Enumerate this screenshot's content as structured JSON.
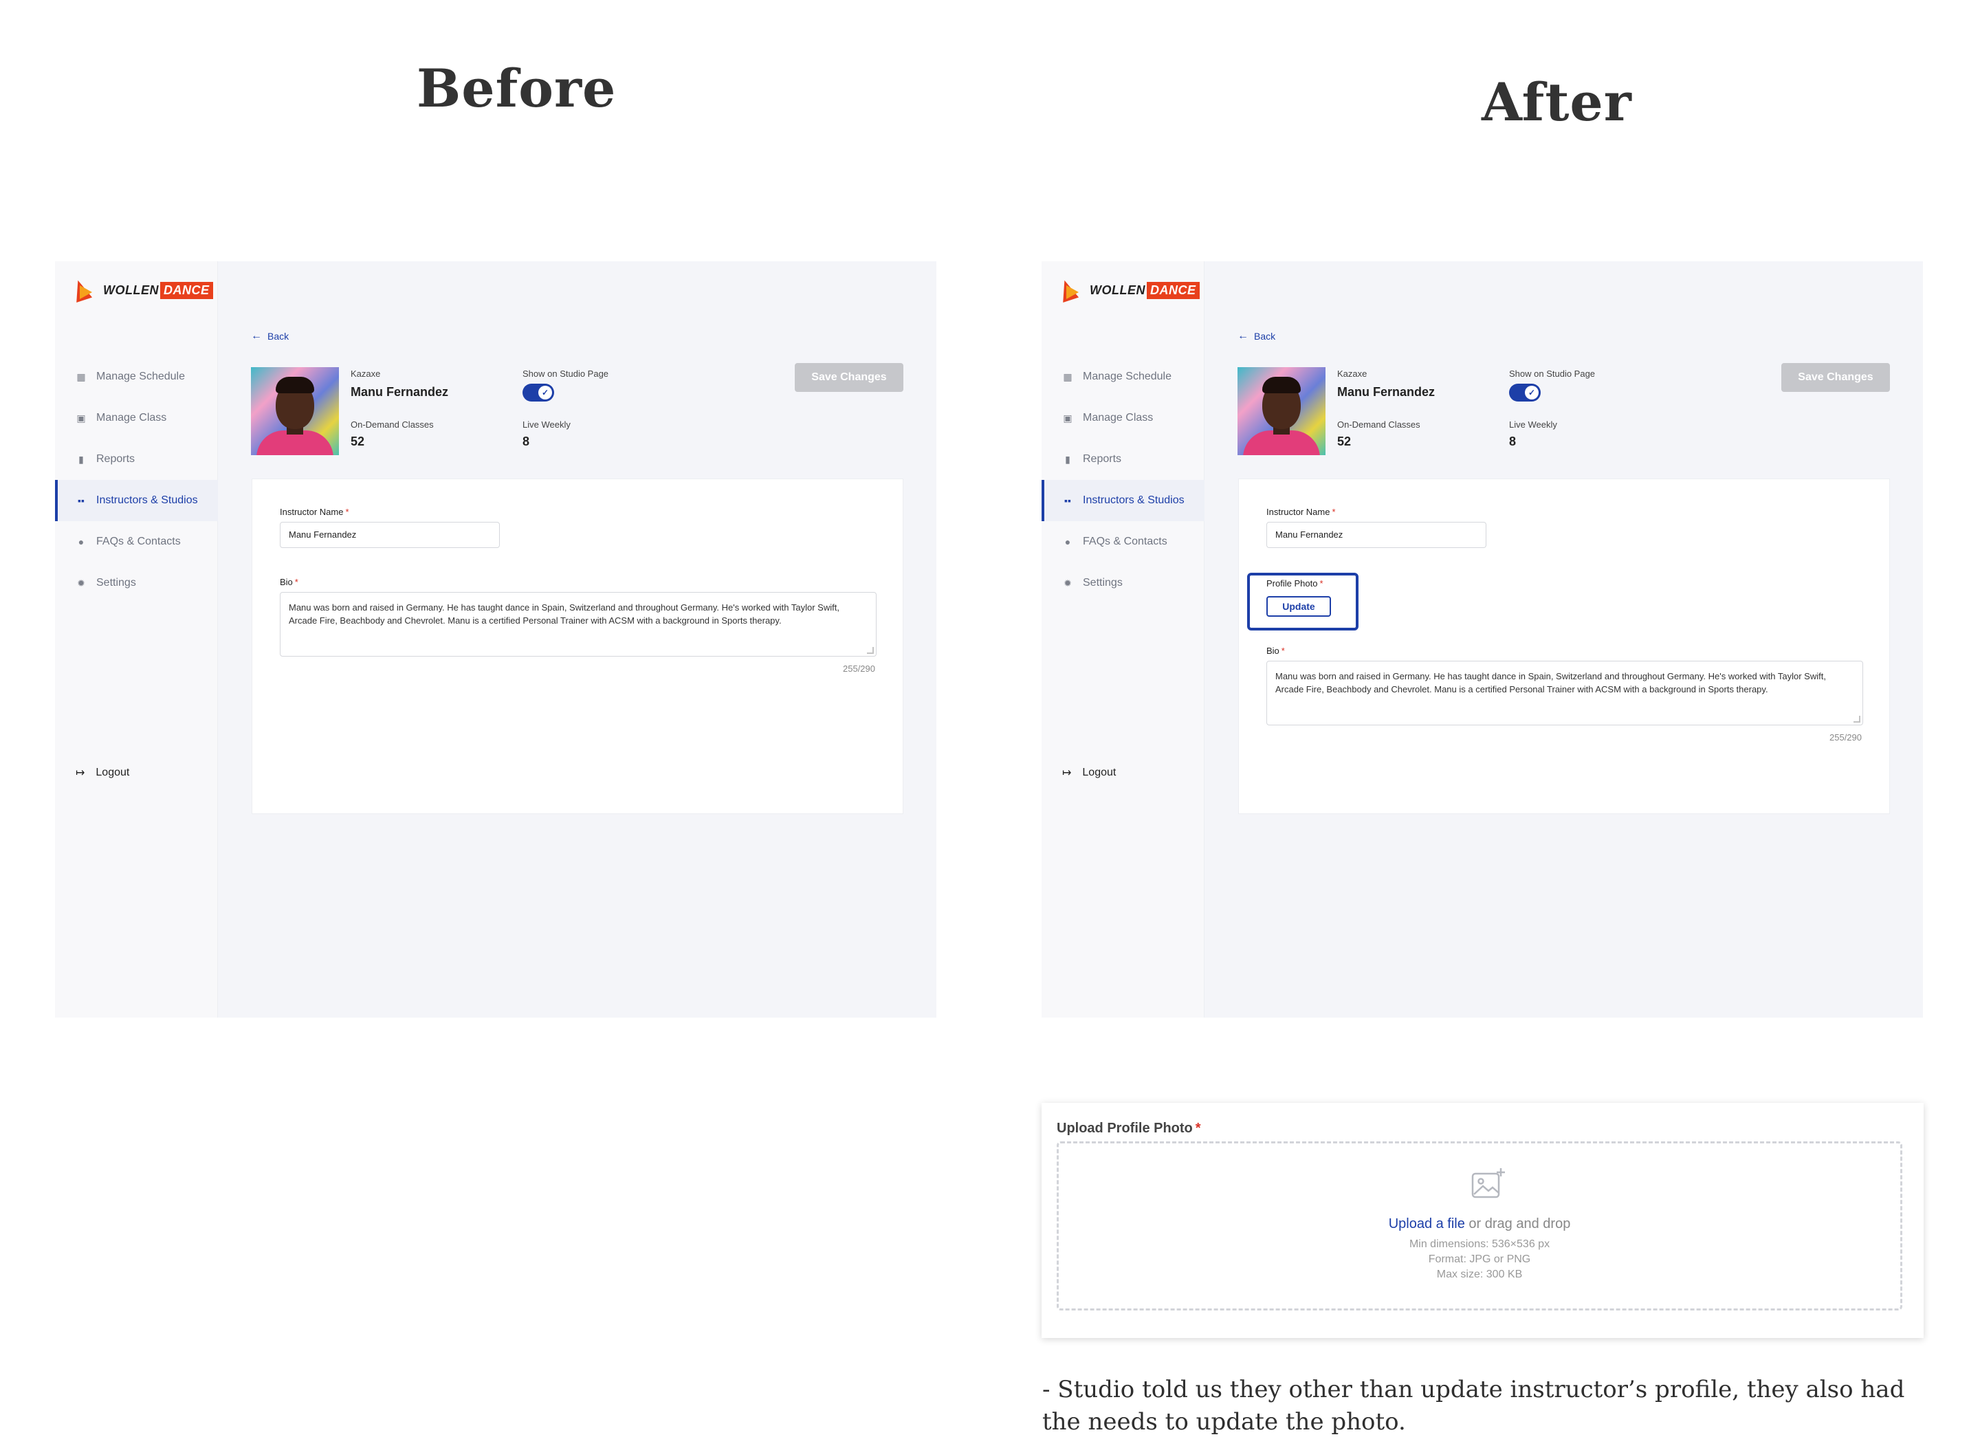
{
  "headings": {
    "before": "Before",
    "after": "After"
  },
  "logo": {
    "text1": "WOLLEN",
    "text2": "DANCE"
  },
  "sidebar": {
    "items": [
      {
        "label": "Manage Schedule",
        "icon": "calendar-icon"
      },
      {
        "label": "Manage Class",
        "icon": "film-icon"
      },
      {
        "label": "Reports",
        "icon": "bar-chart-icon"
      },
      {
        "label": "Instructors & Studios",
        "icon": "grid-icon",
        "active": true
      },
      {
        "label": "FAQs & Contacts",
        "icon": "question-icon"
      },
      {
        "label": "Settings",
        "icon": "gear-icon"
      }
    ],
    "logout": "Logout"
  },
  "profile": {
    "back": "Back",
    "studio": "Kazaxe",
    "name": "Manu Fernandez",
    "show_label": "Show on Studio Page",
    "show_on": true,
    "ondemand_label": "On-Demand Classes",
    "ondemand_value": "52",
    "live_label": "Live Weekly",
    "live_value": "8",
    "save_label": "Save Changes"
  },
  "form": {
    "name_label": "Instructor Name",
    "name_value": "Manu Fernandez",
    "photo_label": "Profile Photo",
    "update_label": "Update",
    "bio_label": "Bio",
    "bio_value": "Manu was born and raised in Germany. He has taught dance in Spain, Switzerland and throughout Germany. He's worked with Taylor Swift, Arcade Fire, Beachbody and Chevrolet. Manu is a certified Personal Trainer with ACSM with a background in Sports therapy.",
    "counter": "255/290",
    "required_mark": "*"
  },
  "upload": {
    "title": "Upload Profile Photo",
    "link": "Upload a file",
    "rest": " or drag and drop",
    "dimensions": "Min dimensions: 536×536 px",
    "format": "Format: JPG or PNG",
    "size": "Max size: 300 KB"
  },
  "note": "- Studio told us they other than update instructor’s profile, they also had the needs to update the photo.",
  "colors": {
    "accent": "#1d3fa8",
    "brand": "#e8401c",
    "required": "#d93025",
    "disabled": "#c6c7cb"
  }
}
